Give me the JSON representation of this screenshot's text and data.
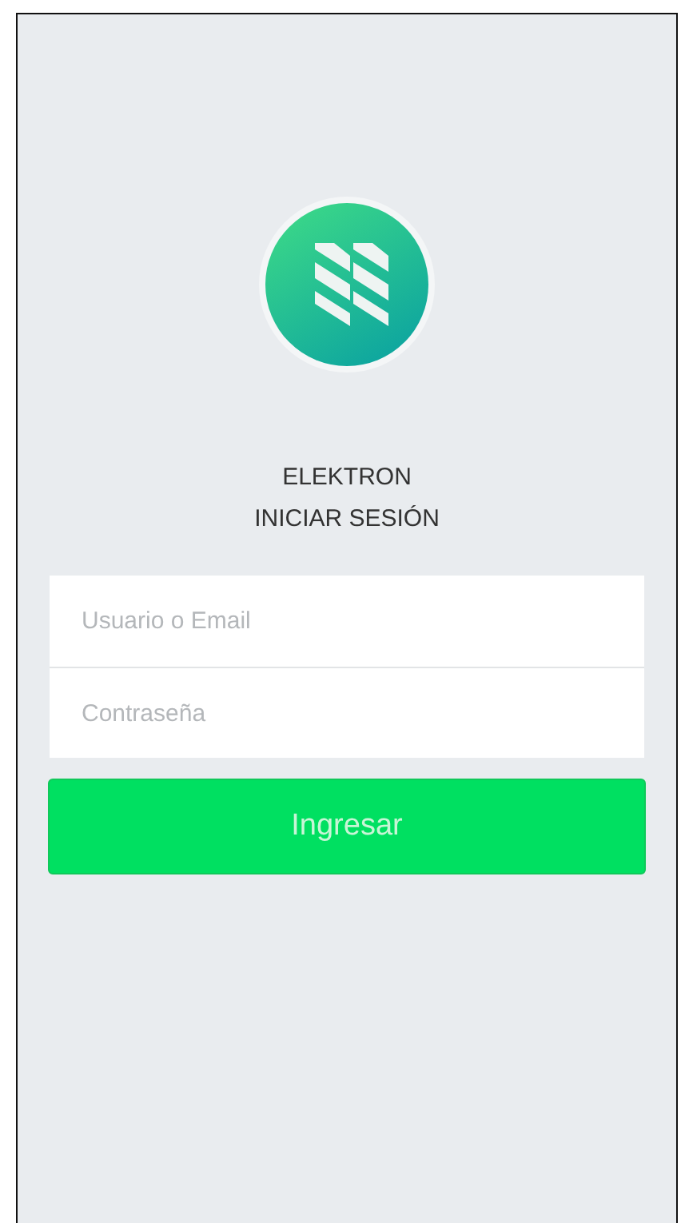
{
  "brand": {
    "name": "ELEKTRON",
    "subtitle": "INICIAR SESIÓN"
  },
  "fields": [
    {
      "placeholder": "Usuario o Email"
    },
    {
      "placeholder": "Contraseña"
    }
  ],
  "submit": {
    "label": "Ingresar"
  }
}
